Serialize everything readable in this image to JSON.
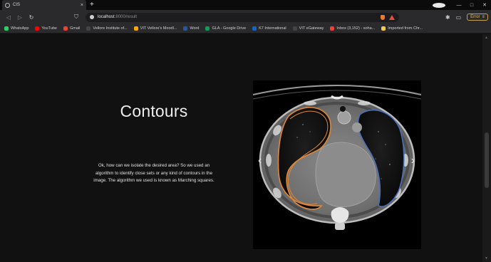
{
  "tab": {
    "title": "CIS",
    "close": "×"
  },
  "toolbar": {
    "url_host": "localhost",
    "url_rest": ":8000/result",
    "error_label": "Error"
  },
  "bookmarks": [
    {
      "label": "WhatsApp",
      "color": "#25d366"
    },
    {
      "label": "YouTube",
      "color": "#ff0000"
    },
    {
      "label": "Gmail",
      "color": "#ea4335"
    },
    {
      "label": "Vellore Institute of...",
      "color": "#444444"
    },
    {
      "label": "VIT Vellore's Moodl...",
      "color": "#f7a800"
    },
    {
      "label": "Word",
      "color": "#2b579a"
    },
    {
      "label": "GLA - Google Drive",
      "color": "#0f9d58"
    },
    {
      "label": "K7 International",
      "color": "#1565c0"
    },
    {
      "label": "VIT eGateway",
      "color": "#444444"
    },
    {
      "label": "Inbox (3,152) - soha...",
      "color": "#ea4335"
    },
    {
      "label": "Imported from Chr...",
      "color": "#f2c94c"
    }
  ],
  "main": {
    "heading": "Contours",
    "description": "Ok, how can we isolate the desired area? So we used an algorithm to identify close sets or any kind of contours in the image. The algorithm we used is known as Marching squares."
  },
  "carousel": {
    "prev": "‹",
    "next": "›"
  },
  "colors": {
    "contour_left": "#e0883a",
    "contour_right": "#4a6fb5"
  }
}
